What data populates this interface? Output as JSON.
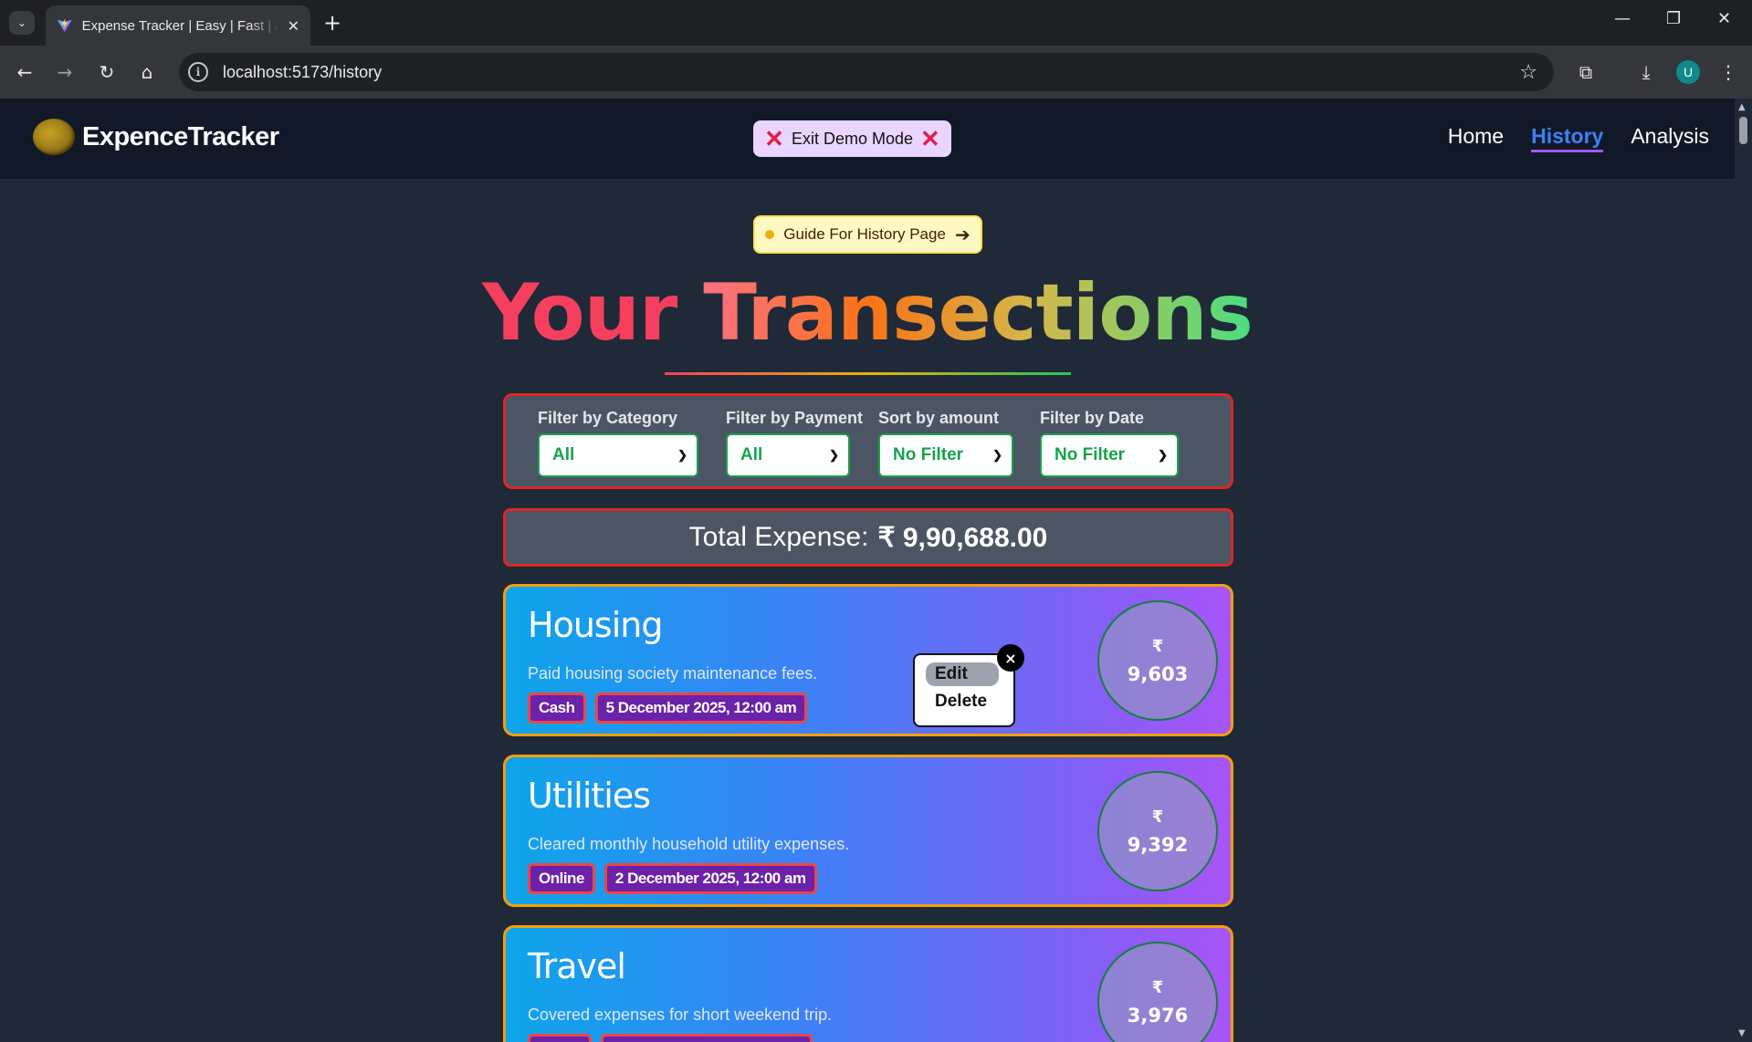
{
  "browser": {
    "tab_title": "Expense Tracker | Easy | Fast | Accurate",
    "url": "localhost:5173/history",
    "profile_initial": "U"
  },
  "site": {
    "logo_text": "ExpenceTracker",
    "demo_button": "Exit Demo Mode",
    "nav": [
      "Home",
      "History",
      "Analysis"
    ],
    "active_nav": "History"
  },
  "guide_button": "Guide For History Page",
  "title": {
    "word1": "Your",
    "word2": "Transections"
  },
  "filters": [
    {
      "label": "Filter by Category",
      "value": "All"
    },
    {
      "label": "Filter by Payment",
      "value": "All"
    },
    {
      "label": "Sort by amount",
      "value": "No Filter"
    },
    {
      "label": "Filter by Date",
      "value": "No Filter"
    }
  ],
  "total": {
    "label": "Total Expense:",
    "amount": "₹ 9,90,688.00"
  },
  "transactions": [
    {
      "category": "Housing",
      "description": "Paid housing society maintenance fees.",
      "payment": "Cash",
      "date": "5 December 2025, 12:00 am",
      "currency": "₹",
      "amount": "9,603"
    },
    {
      "category": "Utilities",
      "description": "Cleared monthly household utility expenses.",
      "payment": "Online",
      "date": "2 December 2025, 12:00 am",
      "currency": "₹",
      "amount": "9,392"
    },
    {
      "category": "Travel",
      "description": "Covered expenses for short weekend trip.",
      "payment": "",
      "date": "",
      "currency": "₹",
      "amount": "3,976"
    }
  ],
  "context_menu": {
    "edit": "Edit",
    "delete": "Delete",
    "close": "×"
  },
  "colors": {
    "accent_nav": "#3b82f6",
    "card_border": "#f59e0b",
    "filter_border": "#dc2626",
    "select_text": "#16a34a"
  }
}
